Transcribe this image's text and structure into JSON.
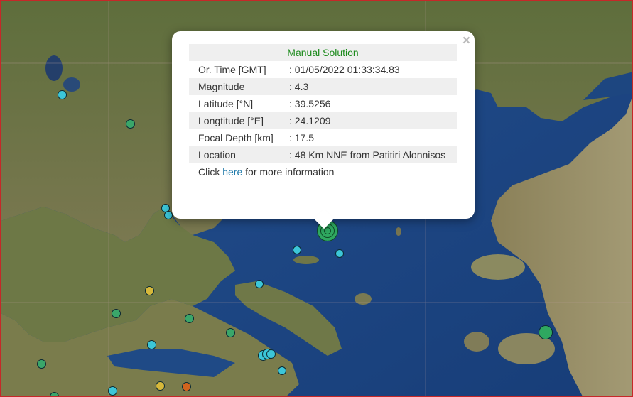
{
  "popup": {
    "title": "Manual Solution",
    "rows": [
      {
        "label": "Or. Time [GMT]",
        "value": ": 01/05/2022 01:33:34.83"
      },
      {
        "label": "Magnitude",
        "value": ": 4.3"
      },
      {
        "label": "Latitude [°N]",
        "value": ": 39.5256"
      },
      {
        "label": "Longtitude [°E]",
        "value": ": 24.1209"
      },
      {
        "label": "Focal Depth [km]",
        "value": ": 17.5"
      },
      {
        "label": "Location",
        "value": ": 48 Km NNE from Patitiri Alonnisos"
      }
    ],
    "more_prefix": "Click ",
    "more_link": "here",
    "more_suffix": " for more information",
    "close_glyph": "×"
  },
  "colors": {
    "sea": "#1e4a8a",
    "marker_cyan": "#3cc6d8",
    "marker_green": "#3aa66a",
    "marker_yellow": "#d6b83a",
    "marker_orange": "#d2641e",
    "selected_event": "#2fa860"
  }
}
